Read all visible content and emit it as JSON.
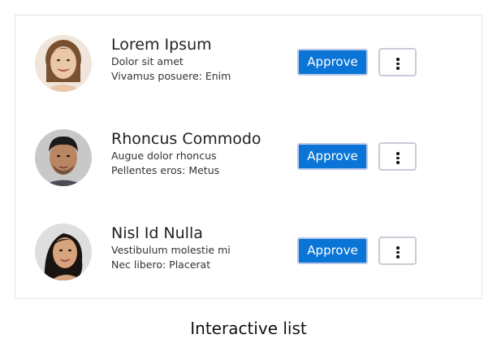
{
  "list": {
    "items": [
      {
        "name": "Lorem Ipsum",
        "subtitle": "Dolor sit amet",
        "detail": "Vivamus posuere: Enim",
        "approve_label": "Approve",
        "avatar": {
          "skin": "#e9c7a7",
          "hair": "#7a5130",
          "bg": "#efe5da"
        }
      },
      {
        "name": "Rhoncus Commodo",
        "subtitle": "Augue dolor rhoncus",
        "detail": "Pellentes eros: Metus",
        "approve_label": "Approve",
        "avatar": {
          "skin": "#b98563",
          "hair": "#1c1a19",
          "bg": "#c8c8c8"
        }
      },
      {
        "name": "Nisl Id Nulla",
        "subtitle": "Vestibulum molestie mi",
        "detail": "Nec libero: Placerat",
        "approve_label": "Approve",
        "avatar": {
          "skin": "#d6a37c",
          "hair": "#1a1411",
          "bg": "#dedede"
        }
      }
    ]
  },
  "caption": "Interactive list",
  "colors": {
    "approve_bg": "#0a75d6",
    "approve_border": "#b9c7e8",
    "more_border": "#c9cbd8",
    "card_border": "#e5e5e5"
  },
  "icons": {
    "more": "more-vertical-icon"
  }
}
